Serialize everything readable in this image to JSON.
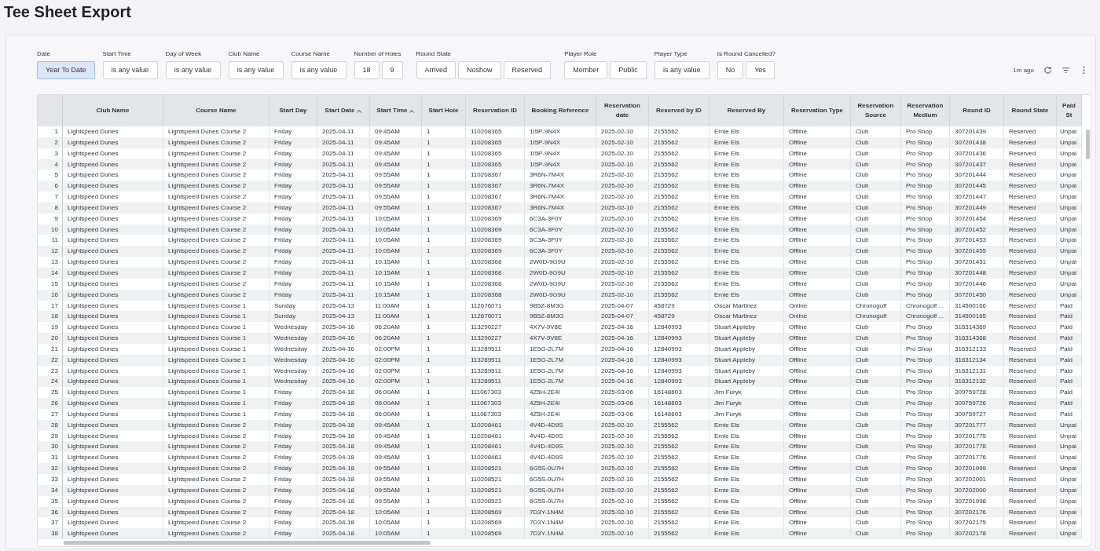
{
  "title": "Tee Sheet Export",
  "filters": [
    {
      "label": "Date",
      "kind": "toggle",
      "options": [
        {
          "label": "Year To Date",
          "selected": true
        }
      ]
    },
    {
      "label": "Start Time",
      "kind": "select",
      "value": "is any value"
    },
    {
      "label": "Day of Week",
      "kind": "select",
      "value": "is any value"
    },
    {
      "label": "Club Name",
      "kind": "select",
      "value": "is any value"
    },
    {
      "label": "Course Name",
      "kind": "select",
      "value": "is any value"
    },
    {
      "label": "Number of Holes",
      "kind": "toggle",
      "options": [
        {
          "label": "18",
          "selected": false
        },
        {
          "label": "9",
          "selected": false
        }
      ]
    },
    {
      "label": "Round State",
      "kind": "toggle",
      "options": [
        {
          "label": "Arrived",
          "selected": false
        },
        {
          "label": "Noshow",
          "selected": false
        },
        {
          "label": "Reserved",
          "selected": false
        }
      ]
    },
    {
      "label": "Player Role",
      "kind": "toggle",
      "options": [
        {
          "label": "Member",
          "selected": false
        },
        {
          "label": "Public",
          "selected": false
        }
      ]
    },
    {
      "label": "Player Type",
      "kind": "select",
      "value": "is any value"
    },
    {
      "label": "Is Round Cancelled?",
      "kind": "toggle",
      "options": [
        {
          "label": "No",
          "selected": false
        },
        {
          "label": "Yes",
          "selected": false
        }
      ]
    }
  ],
  "updated": "1m ago",
  "table": {
    "columns": [
      {},
      {
        "label": "Club Name"
      },
      {
        "label": "Course Name"
      },
      {
        "label": "Start Day"
      },
      {
        "label": "Start Date",
        "sorted": true
      },
      {
        "label": "Start Time",
        "sorted": true
      },
      {
        "label": "Start Hole"
      },
      {
        "label": "Reservation ID"
      },
      {
        "label": "Booking Reference"
      },
      {
        "label": "Reservation date"
      },
      {
        "label": "Reserved by ID"
      },
      {
        "label": "Reserved By"
      },
      {
        "label": "Reservation Type"
      },
      {
        "label": "Reservation Source"
      },
      {
        "label": "Reservation Medium"
      },
      {
        "label": "Round ID"
      },
      {
        "label": "Round State"
      },
      {
        "label": "Paid St"
      }
    ],
    "rows": [
      [
        "1",
        "Lightspeed Dunes",
        "Lightspeed Dunes Course 2",
        "Friday",
        "2025-04-11",
        "09:45AM",
        "1",
        "110208365",
        "1I5P-9N4X",
        "2025-02-10",
        "2155562",
        "Ernie Els",
        "Offline",
        "Club",
        "Pro Shop",
        "307201439",
        "Reserved",
        "Unpai"
      ],
      [
        "2",
        "Lightspeed Dunes",
        "Lightspeed Dunes Course 2",
        "Friday",
        "2025-04-11",
        "09:45AM",
        "1",
        "110208365",
        "1I5P-9N4X",
        "2025-02-10",
        "2155562",
        "Ernie Els",
        "Offline",
        "Club",
        "Pro Shop",
        "307201438",
        "Reserved",
        "Unpai"
      ],
      [
        "3",
        "Lightspeed Dunes",
        "Lightspeed Dunes Course 2",
        "Friday",
        "2025-04-11",
        "09:45AM",
        "1",
        "110208365",
        "1I5P-9N4X",
        "2025-02-10",
        "2155562",
        "Ernie Els",
        "Offline",
        "Club",
        "Pro Shop",
        "307201436",
        "Reserved",
        "Unpai"
      ],
      [
        "4",
        "Lightspeed Dunes",
        "Lightspeed Dunes Course 2",
        "Friday",
        "2025-04-11",
        "09:45AM",
        "1",
        "110208365",
        "1I5P-9N4X",
        "2025-02-10",
        "2155562",
        "Ernie Els",
        "Offline",
        "Club",
        "Pro Shop",
        "307201437",
        "Reserved",
        "Unpai"
      ],
      [
        "5",
        "Lightspeed Dunes",
        "Lightspeed Dunes Course 2",
        "Friday",
        "2025-04-11",
        "09:55AM",
        "1",
        "110208367",
        "3R6N-7M4X",
        "2025-02-10",
        "2155562",
        "Ernie Els",
        "Offline",
        "Club",
        "Pro Shop",
        "307201444",
        "Reserved",
        "Unpai"
      ],
      [
        "6",
        "Lightspeed Dunes",
        "Lightspeed Dunes Course 2",
        "Friday",
        "2025-04-11",
        "09:55AM",
        "1",
        "110208367",
        "3R6N-7M4X",
        "2025-02-10",
        "2155562",
        "Ernie Els",
        "Offline",
        "Club",
        "Pro Shop",
        "307201445",
        "Reserved",
        "Unpai"
      ],
      [
        "7",
        "Lightspeed Dunes",
        "Lightspeed Dunes Course 2",
        "Friday",
        "2025-04-11",
        "09:55AM",
        "1",
        "110208367",
        "3R6N-7M4X",
        "2025-02-10",
        "2155562",
        "Ernie Els",
        "Offline",
        "Club",
        "Pro Shop",
        "307201447",
        "Reserved",
        "Unpai"
      ],
      [
        "8",
        "Lightspeed Dunes",
        "Lightspeed Dunes Course 2",
        "Friday",
        "2025-04-11",
        "09:55AM",
        "1",
        "110208367",
        "3R6N-7M4X",
        "2025-02-10",
        "2155562",
        "Ernie Els",
        "Offline",
        "Club",
        "Pro Shop",
        "307201449",
        "Reserved",
        "Unpai"
      ],
      [
        "9",
        "Lightspeed Dunes",
        "Lightspeed Dunes Course 2",
        "Friday",
        "2025-04-11",
        "10:05AM",
        "1",
        "110208369",
        "6C3A-3F0Y",
        "2025-02-10",
        "2155562",
        "Ernie Els",
        "Offline",
        "Club",
        "Pro Shop",
        "307201454",
        "Reserved",
        "Unpai"
      ],
      [
        "10",
        "Lightspeed Dunes",
        "Lightspeed Dunes Course 2",
        "Friday",
        "2025-04-11",
        "10:05AM",
        "1",
        "110208369",
        "6C3A-3F0Y",
        "2025-02-10",
        "2155562",
        "Ernie Els",
        "Offline",
        "Club",
        "Pro Shop",
        "307201452",
        "Reserved",
        "Unpai"
      ],
      [
        "11",
        "Lightspeed Dunes",
        "Lightspeed Dunes Course 2",
        "Friday",
        "2025-04-11",
        "10:05AM",
        "1",
        "110208369",
        "6C3A-3F0Y",
        "2025-02-10",
        "2155562",
        "Ernie Els",
        "Offline",
        "Club",
        "Pro Shop",
        "307201453",
        "Reserved",
        "Unpai"
      ],
      [
        "12",
        "Lightspeed Dunes",
        "Lightspeed Dunes Course 2",
        "Friday",
        "2025-04-11",
        "10:05AM",
        "1",
        "110208369",
        "6C3A-3F0Y",
        "2025-02-10",
        "2155562",
        "Ernie Els",
        "Offline",
        "Club",
        "Pro Shop",
        "307201455",
        "Reserved",
        "Unpai"
      ],
      [
        "13",
        "Lightspeed Dunes",
        "Lightspeed Dunes Course 2",
        "Friday",
        "2025-04-11",
        "10:15AM",
        "1",
        "110208368",
        "2W0D-9G9U",
        "2025-02-10",
        "2155562",
        "Ernie Els",
        "Offline",
        "Club",
        "Pro Shop",
        "307201451",
        "Reserved",
        "Unpai"
      ],
      [
        "14",
        "Lightspeed Dunes",
        "Lightspeed Dunes Course 2",
        "Friday",
        "2025-04-11",
        "10:15AM",
        "1",
        "110208368",
        "2W0D-9G9U",
        "2025-02-10",
        "2155562",
        "Ernie Els",
        "Offline",
        "Club",
        "Pro Shop",
        "307201448",
        "Reserved",
        "Unpai"
      ],
      [
        "15",
        "Lightspeed Dunes",
        "Lightspeed Dunes Course 2",
        "Friday",
        "2025-04-11",
        "10:15AM",
        "1",
        "110208368",
        "2W0D-9G9U",
        "2025-02-10",
        "2155562",
        "Ernie Els",
        "Offline",
        "Club",
        "Pro Shop",
        "307201446",
        "Reserved",
        "Unpai"
      ],
      [
        "16",
        "Lightspeed Dunes",
        "Lightspeed Dunes Course 2",
        "Friday",
        "2025-04-11",
        "10:15AM",
        "1",
        "110208368",
        "2W0D-9G9U",
        "2025-02-10",
        "2155562",
        "Ernie Els",
        "Offline",
        "Club",
        "Pro Shop",
        "307201450",
        "Reserved",
        "Unpai"
      ],
      [
        "17",
        "Lightspeed Dunes",
        "Lightspeed Dunes Course 1",
        "Sunday",
        "2025-04-13",
        "11:00AM",
        "1",
        "112676071",
        "9B5Z-8M3G",
        "2025-04-07",
        "458729",
        "Oscar Martinez",
        "Online",
        "Chronogolf",
        "Chronogolf ...",
        "314500166",
        "Reserved",
        "Paid"
      ],
      [
        "18",
        "Lightspeed Dunes",
        "Lightspeed Dunes Course 1",
        "Sunday",
        "2025-04-13",
        "11:00AM",
        "1",
        "112676071",
        "9B5Z-8M3G",
        "2025-04-07",
        "458729",
        "Oscar Martinez",
        "Online",
        "Chronogolf",
        "Chronogolf ...",
        "314500165",
        "Reserved",
        "Paid"
      ],
      [
        "19",
        "Lightspeed Dunes",
        "Lightspeed Dunes Course 1",
        "Wednesday",
        "2025-04-16",
        "06:20AM",
        "1",
        "113290227",
        "4X7V-9V8E",
        "2025-04-16",
        "12840993",
        "Stuart Appleby",
        "Offline",
        "Club",
        "Pro Shop",
        "316314369",
        "Reserved",
        "Paid"
      ],
      [
        "20",
        "Lightspeed Dunes",
        "Lightspeed Dunes Course 1",
        "Wednesday",
        "2025-04-16",
        "06:20AM",
        "1",
        "113290227",
        "4X7V-9V8E",
        "2025-04-16",
        "12840993",
        "Stuart Appleby",
        "Offline",
        "Club",
        "Pro Shop",
        "316314368",
        "Reserved",
        "Paid"
      ],
      [
        "21",
        "Lightspeed Dunes",
        "Lightspeed Dunes Course 1",
        "Wednesday",
        "2025-04-16",
        "02:00PM",
        "1",
        "113289511",
        "1E5G-2L7M",
        "2025-04-16",
        "12840993",
        "Stuart Appleby",
        "Offline",
        "Club",
        "Pro Shop",
        "316312133",
        "Reserved",
        "Paid"
      ],
      [
        "22",
        "Lightspeed Dunes",
        "Lightspeed Dunes Course 1",
        "Wednesday",
        "2025-04-16",
        "02:00PM",
        "1",
        "113289511",
        "1E5G-2L7M",
        "2025-04-16",
        "12840993",
        "Stuart Appleby",
        "Offline",
        "Club",
        "Pro Shop",
        "316312134",
        "Reserved",
        "Paid"
      ],
      [
        "23",
        "Lightspeed Dunes",
        "Lightspeed Dunes Course 1",
        "Wednesday",
        "2025-04-16",
        "02:00PM",
        "1",
        "113289511",
        "1E5G-2L7M",
        "2025-04-16",
        "12840993",
        "Stuart Appleby",
        "Offline",
        "Club",
        "Pro Shop",
        "316312131",
        "Reserved",
        "Paid"
      ],
      [
        "24",
        "Lightspeed Dunes",
        "Lightspeed Dunes Course 1",
        "Wednesday",
        "2025-04-16",
        "02:00PM",
        "1",
        "113289511",
        "1E5G-2L7M",
        "2025-04-16",
        "12840993",
        "Stuart Appleby",
        "Offline",
        "Club",
        "Pro Shop",
        "316312132",
        "Reserved",
        "Paid"
      ],
      [
        "25",
        "Lightspeed Dunes",
        "Lightspeed Dunes Course 1",
        "Friday",
        "2025-04-18",
        "06:00AM",
        "1",
        "111067303",
        "4Z5H-2E4I",
        "2025-03-06",
        "16148603",
        "Jim Furyk",
        "Offline",
        "Club",
        "Pro Shop",
        "309759728",
        "Reserved",
        "Paid"
      ],
      [
        "26",
        "Lightspeed Dunes",
        "Lightspeed Dunes Course 1",
        "Friday",
        "2025-04-18",
        "06:00AM",
        "1",
        "111067303",
        "4Z5H-2E4I",
        "2025-03-06",
        "16148603",
        "Jim Furyk",
        "Offline",
        "Club",
        "Pro Shop",
        "309759726",
        "Reserved",
        "Paid"
      ],
      [
        "27",
        "Lightspeed Dunes",
        "Lightspeed Dunes Course 1",
        "Friday",
        "2025-04-18",
        "06:00AM",
        "1",
        "111067303",
        "4Z5H-2E4I",
        "2025-03-06",
        "16148603",
        "Jim Furyk",
        "Offline",
        "Club",
        "Pro Shop",
        "309759727",
        "Reserved",
        "Paid"
      ],
      [
        "28",
        "Lightspeed Dunes",
        "Lightspeed Dunes Course 2",
        "Friday",
        "2025-04-18",
        "09:45AM",
        "1",
        "110208461",
        "4V4D-4D9S",
        "2025-02-10",
        "2155562",
        "Ernie Els",
        "Offline",
        "Club",
        "Pro Shop",
        "307201777",
        "Reserved",
        "Unpai"
      ],
      [
        "29",
        "Lightspeed Dunes",
        "Lightspeed Dunes Course 2",
        "Friday",
        "2025-04-18",
        "09:45AM",
        "1",
        "110208461",
        "4V4D-4D9S",
        "2025-02-10",
        "2155562",
        "Ernie Els",
        "Offline",
        "Club",
        "Pro Shop",
        "307201775",
        "Reserved",
        "Unpai"
      ],
      [
        "30",
        "Lightspeed Dunes",
        "Lightspeed Dunes Course 2",
        "Friday",
        "2025-04-18",
        "09:45AM",
        "1",
        "110208461",
        "4V4D-4D9S",
        "2025-02-10",
        "2155562",
        "Ernie Els",
        "Offline",
        "Club",
        "Pro Shop",
        "307201778",
        "Reserved",
        "Unpai"
      ],
      [
        "31",
        "Lightspeed Dunes",
        "Lightspeed Dunes Course 2",
        "Friday",
        "2025-04-18",
        "09:45AM",
        "1",
        "110208461",
        "4V4D-4D9S",
        "2025-02-10",
        "2155562",
        "Ernie Els",
        "Offline",
        "Club",
        "Pro Shop",
        "307201776",
        "Reserved",
        "Unpai"
      ],
      [
        "32",
        "Lightspeed Dunes",
        "Lightspeed Dunes Course 2",
        "Friday",
        "2025-04-18",
        "09:55AM",
        "1",
        "110208521",
        "6G5S-0U7H",
        "2025-02-10",
        "2155562",
        "Ernie Els",
        "Offline",
        "Club",
        "Pro Shop",
        "307201999",
        "Reserved",
        "Unpai"
      ],
      [
        "33",
        "Lightspeed Dunes",
        "Lightspeed Dunes Course 2",
        "Friday",
        "2025-04-18",
        "09:55AM",
        "1",
        "110208521",
        "6G5S-0U7H",
        "2025-02-10",
        "2155562",
        "Ernie Els",
        "Offline",
        "Club",
        "Pro Shop",
        "307202001",
        "Reserved",
        "Unpai"
      ],
      [
        "34",
        "Lightspeed Dunes",
        "Lightspeed Dunes Course 2",
        "Friday",
        "2025-04-18",
        "09:55AM",
        "1",
        "110208521",
        "6G5S-0U7H",
        "2025-02-10",
        "2155562",
        "Ernie Els",
        "Offline",
        "Club",
        "Pro Shop",
        "307202000",
        "Reserved",
        "Unpai"
      ],
      [
        "35",
        "Lightspeed Dunes",
        "Lightspeed Dunes Course 2",
        "Friday",
        "2025-04-18",
        "09:55AM",
        "1",
        "110208521",
        "6G5S-0U7H",
        "2025-02-10",
        "2155562",
        "Ernie Els",
        "Offline",
        "Club",
        "Pro Shop",
        "307201998",
        "Reserved",
        "Unpai"
      ],
      [
        "36",
        "Lightspeed Dunes",
        "Lightspeed Dunes Course 2",
        "Friday",
        "2025-04-18",
        "10:05AM",
        "1",
        "110208569",
        "7D3Y-1N4M",
        "2025-02-10",
        "2155562",
        "Ernie Els",
        "Offline",
        "Club",
        "Pro Shop",
        "307202176",
        "Reserved",
        "Unpai"
      ],
      [
        "37",
        "Lightspeed Dunes",
        "Lightspeed Dunes Course 2",
        "Friday",
        "2025-04-18",
        "10:05AM",
        "1",
        "110208569",
        "7D3Y-1N4M",
        "2025-02-10",
        "2155562",
        "Ernie Els",
        "Offline",
        "Club",
        "Pro Shop",
        "307202175",
        "Reserved",
        "Unpai"
      ],
      [
        "38",
        "Lightspeed Dunes",
        "Lightspeed Dunes Course 2",
        "Friday",
        "2025-04-18",
        "10:05AM",
        "1",
        "110208569",
        "7D3Y-1N4M",
        "2025-02-10",
        "2155562",
        "Ernie Els",
        "Offline",
        "Club",
        "Pro Shop",
        "307202178",
        "Reserved",
        "Unpai"
      ]
    ]
  }
}
